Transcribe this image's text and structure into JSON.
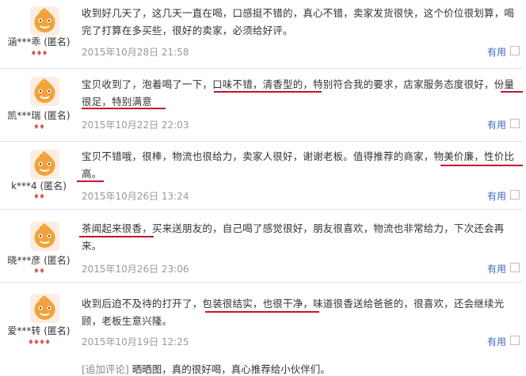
{
  "reviews": [
    {
      "user": "涵***乖 (匿名)",
      "content": "收到好几天了，这几天一直在喝，口感挺不错的，真心不错，卖家发货很快，这个价位很划算，喝完了打算在多买些，很好的卖家，必须给好评。",
      "date": "2015年10月28日 21:58",
      "useful": "有用",
      "badge": "♦♦♦"
    },
    {
      "user": "凯***瑞 (匿名)",
      "content": "宝贝收到了，泡着喝了一下，口味不错，清香型的，特别符合我的要求，店家服务态度很好，份量很足，特别满意",
      "date": "2015年10月22日 22:03",
      "useful": "有用",
      "badge": "♦♦"
    },
    {
      "user": "k***4 (匿名)",
      "content": "宝贝不错哦，很棒，物流也很给力，卖家人很好，谢谢老板。值得推荐的商家，物美价廉，性价比高。",
      "date": "2015年10月26日 13:24",
      "useful": "有用",
      "badge": "♦♦"
    },
    {
      "user": "晓***彦 (匿名)",
      "content": "茶闻起来很香，买来送朋友的，自己喝了感觉很好，朋友很喜欢，物流也非常给力，下次还会再来。",
      "date": "2015年10月26日 23:06",
      "useful": "有用",
      "badge": "♦♦"
    },
    {
      "user": "爱***转 (匿名)",
      "content": "收到后迫不及待的打开了，包装很结实，也很干净，味道很香送给爸爸的，很喜欢，还会继续光顾，老板生意兴隆。",
      "date": "2015年10月19日 12:25",
      "useful": "有用",
      "badge": "♦♦♦♦"
    }
  ],
  "append": {
    "tag": "[追加评论]",
    "text": "晒晒图，真的很好喝，真心推荐给小伙伴们。"
  },
  "colors": {
    "underline": "#c8102e",
    "useful_link": "#3a6cb4",
    "date": "#999999"
  },
  "icons": {
    "avatar": "cartoon-avatar-icon",
    "badge": "diamond-badge-icon"
  }
}
